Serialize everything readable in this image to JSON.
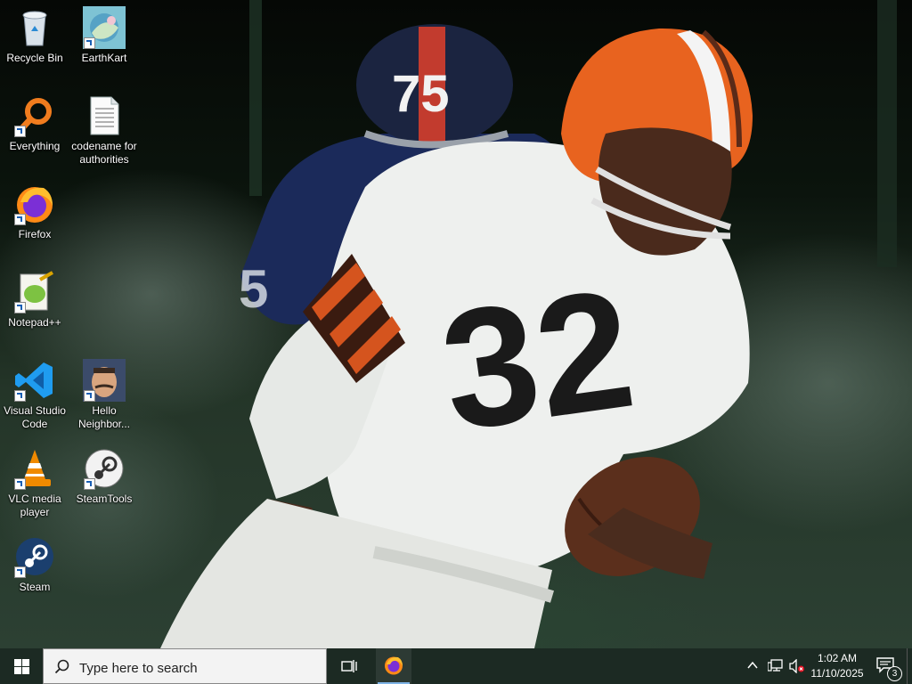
{
  "desktop": {
    "icons": [
      {
        "label": "Recycle Bin",
        "icon": "recycle-bin-icon"
      },
      {
        "label": "EarthKart",
        "icon": "earthkart-icon"
      },
      {
        "label": "Everything",
        "icon": "everything-search-icon"
      },
      {
        "label": "codename for authorities",
        "icon": "text-document-icon"
      },
      {
        "label": "Firefox",
        "icon": "firefox-icon"
      },
      {
        "label": "Notepad++",
        "icon": "notepad-plus-plus-icon"
      },
      {
        "label": "Visual Studio Code",
        "icon": "vscode-icon"
      },
      {
        "label": "Hello Neighbor...",
        "icon": "hello-neighbor-icon"
      },
      {
        "label": "VLC media player",
        "icon": "vlc-icon"
      },
      {
        "label": "SteamTools",
        "icon": "steamtools-icon"
      },
      {
        "label": "Steam",
        "icon": "steam-icon"
      }
    ],
    "wallpaper": {
      "helmet_numbers": "75",
      "jersey_number": "32",
      "colors": {
        "helmet_orange": "#e8631f",
        "helmet_navy": "#1b2440",
        "jersey_white": "#eef0ee",
        "stripe_brown": "#4a2416"
      }
    }
  },
  "taskbar": {
    "search_placeholder": "Type here to search",
    "pinned": [
      {
        "name": "Task View",
        "icon": "task-view-icon"
      },
      {
        "name": "Firefox",
        "icon": "firefox-icon",
        "active": true
      }
    ],
    "tray": {
      "icons": [
        "chevron-up-icon",
        "network-icon",
        "volume-muted-icon"
      ],
      "time": "1:02 AM",
      "date": "11/10/2025",
      "notification_count": "3"
    },
    "colors": {
      "background": "#1c2a23",
      "search_bg": "#f3f3f3",
      "accent": "#7fb4e6"
    }
  }
}
